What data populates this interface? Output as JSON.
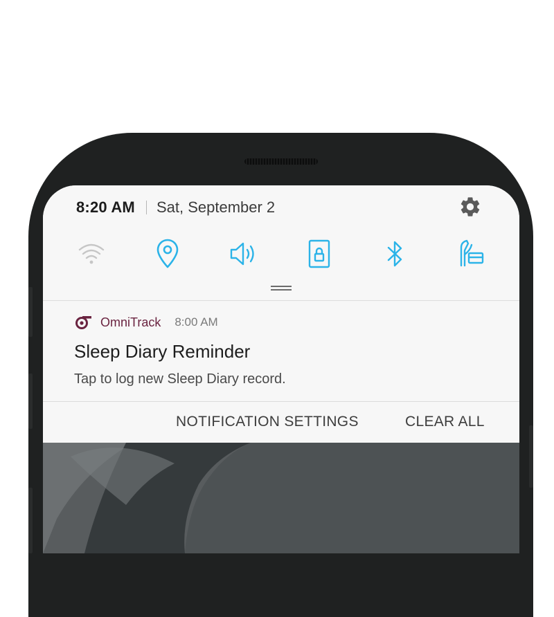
{
  "status": {
    "time": "8:20 AM",
    "date": "Sat, September 2"
  },
  "quick_settings": [
    {
      "name": "wifi",
      "icon": "wifi-icon",
      "active": false
    },
    {
      "name": "location",
      "icon": "location-pin-icon",
      "active": true
    },
    {
      "name": "sound",
      "icon": "speaker-icon",
      "active": true
    },
    {
      "name": "screen-lock",
      "icon": "lock-rotation-icon",
      "active": true
    },
    {
      "name": "bluetooth",
      "icon": "bluetooth-icon",
      "active": true
    },
    {
      "name": "power-saving",
      "icon": "power-saving-icon",
      "active": true
    }
  ],
  "colors": {
    "accent": "#2bb3e8",
    "inactive": "#c6c6c6",
    "app": "#6a2340"
  },
  "notification": {
    "app_name": "OmniTrack",
    "time": "8:00 AM",
    "title": "Sleep Diary Reminder",
    "body": "Tap to log new Sleep Diary record."
  },
  "actions": {
    "settings_label": "NOTIFICATION SETTINGS",
    "clear_label": "CLEAR ALL"
  }
}
